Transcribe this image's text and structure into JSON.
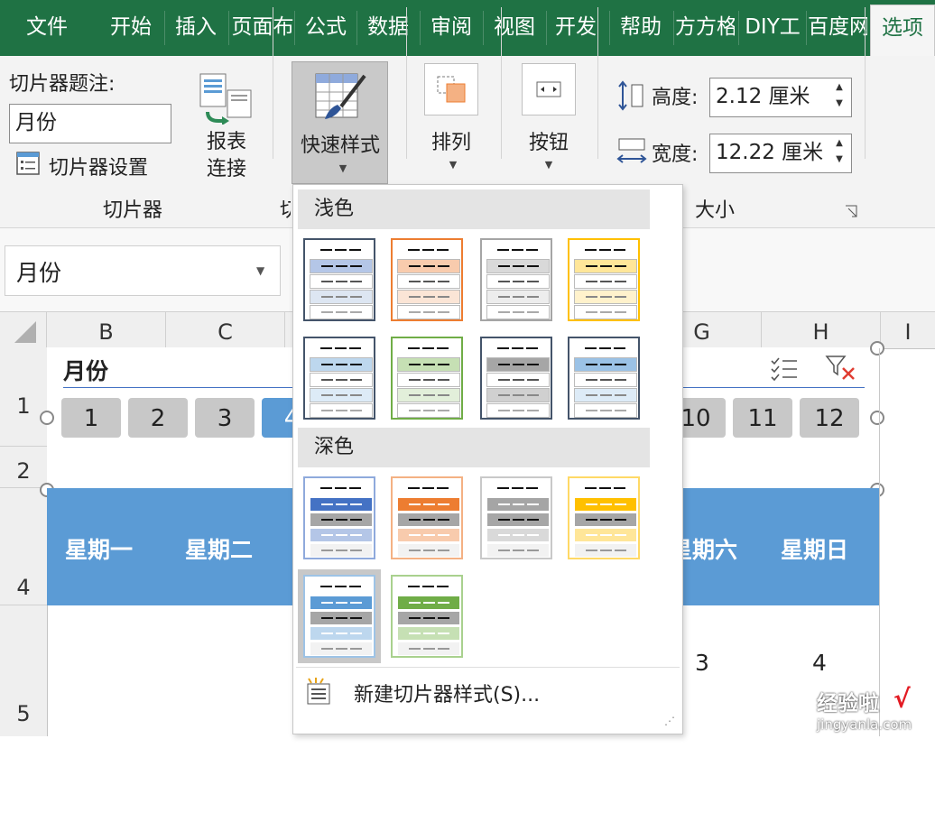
{
  "tabs": [
    {
      "label": "文件",
      "selected": false
    },
    {
      "label": "开始",
      "selected": false
    },
    {
      "label": "插入",
      "selected": false
    },
    {
      "label": "页面布",
      "selected": false
    },
    {
      "label": "公式",
      "selected": false
    },
    {
      "label": "数据",
      "selected": false
    },
    {
      "label": "审阅",
      "selected": false
    },
    {
      "label": "视图",
      "selected": false
    },
    {
      "label": "开发",
      "selected": false
    },
    {
      "label": "帮助",
      "selected": false
    },
    {
      "label": "方方格",
      "selected": false
    },
    {
      "label": "DIY工",
      "selected": false
    },
    {
      "label": "百度网",
      "selected": false
    },
    {
      "label": "选项",
      "selected": true
    }
  ],
  "ribbon": {
    "caption_label": "切片器题注:",
    "caption_value": "月份",
    "settings_label": "切片器设置",
    "report_conn_line1": "报表",
    "report_conn_line2": "连接",
    "group_slicer": "切片器",
    "group_styles_partial": "切",
    "quick_styles_label": "快速样式",
    "arrange_label": "排列",
    "buttons_label": "按钮",
    "height_label": "高度:",
    "height_value": "2.12 厘米",
    "width_label": "宽度:",
    "width_value": "12.22 厘米",
    "group_size": "大小"
  },
  "name_box": {
    "value": "月份"
  },
  "columns": [
    "B",
    "C",
    "G",
    "H",
    "I"
  ],
  "rows": [
    "1",
    "2",
    "4",
    "5"
  ],
  "slicer": {
    "title": "月份",
    "items_left": [
      "1",
      "2",
      "3",
      "4"
    ],
    "items_right": [
      "10",
      "11",
      "12"
    ]
  },
  "weekdays": {
    "mon": "星期一",
    "tue": "星期二",
    "sat": "星期六",
    "sun": "星期日"
  },
  "cells": {
    "sat": "3",
    "sun": "4"
  },
  "gallery": {
    "light_header": "浅色",
    "dark_header": "深色",
    "new_style": "新建切片器样式(S)...",
    "light": [
      {
        "border": "#44546a",
        "accent": "#b4c6e7",
        "tint": "#dde6f2"
      },
      {
        "border": "#ed7d31",
        "accent": "#f8cbad",
        "tint": "#fbe5d6"
      },
      {
        "border": "#a5a5a5",
        "accent": "#d9d9d9",
        "tint": "#ededed"
      },
      {
        "border": "#ffc000",
        "accent": "#ffe699",
        "tint": "#fff2cc"
      },
      {
        "border": "#44546a",
        "accent": "#bdd7ee",
        "tint": "#ddebf7"
      },
      {
        "border": "#70ad47",
        "accent": "#c6e0b4",
        "tint": "#e2efda"
      },
      {
        "border": "#44546a",
        "accent": "#a6a6a6",
        "tint": "#d0d0d0"
      },
      {
        "border": "#44546a",
        "accent": "#9bc2e6",
        "tint": "#ddebf7"
      }
    ],
    "dark": [
      {
        "border": "#8faadc",
        "accent": "#4472c4",
        "tint": "#b4c6e7"
      },
      {
        "border": "#f4b183",
        "accent": "#ed7d31",
        "tint": "#f8cbad"
      },
      {
        "border": "#c9c9c9",
        "accent": "#a5a5a5",
        "tint": "#d9d9d9"
      },
      {
        "border": "#ffd966",
        "accent": "#ffc000",
        "tint": "#ffe699"
      },
      {
        "border": "#9dc3e6",
        "accent": "#5b9bd5",
        "tint": "#bdd7ee"
      },
      {
        "border": "#a9d18e",
        "accent": "#70ad47",
        "tint": "#c6e0b4"
      }
    ]
  },
  "watermark": {
    "line1": "经验啦",
    "line2": "jingyanla.com"
  },
  "colors": {
    "excel_green": "#1f7244",
    "slicer_blue": "#5b9bd5",
    "selected_item": "#5b9bd5"
  }
}
